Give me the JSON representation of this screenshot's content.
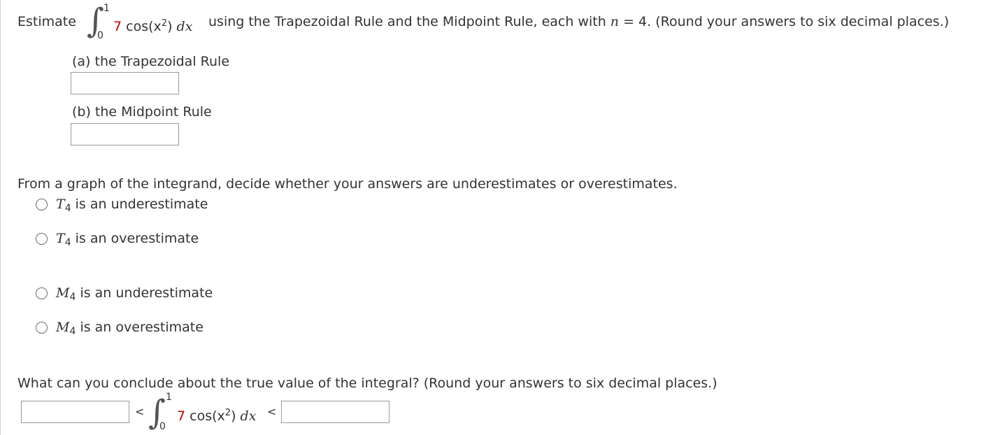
{
  "question": {
    "estimate_label": "Estimate",
    "integral_upper": "1",
    "integral_lower": "0",
    "coefficient": "7",
    "integrand_func": "cos(x",
    "exponent": "2",
    "integrand_close": ")",
    "dx": "dx",
    "instruction_prefix": "using the Trapezoidal Rule and the Midpoint Rule, each with",
    "n_var": "n",
    "instruction_suffix": "= 4. (Round your answers to six decimal places.)"
  },
  "part_a": {
    "label": "(a) the Trapezoidal Rule",
    "value": ""
  },
  "part_b": {
    "label": "(b) the Midpoint Rule",
    "value": ""
  },
  "graph_question": "From a graph of the integrand, decide whether your answers are underestimates or overestimates.",
  "options": [
    {
      "var": "T",
      "sub": "4",
      "text": "is an underestimate"
    },
    {
      "var": "T",
      "sub": "4",
      "text": "is an overestimate"
    },
    {
      "var": "M",
      "sub": "4",
      "text": "is an underestimate"
    },
    {
      "var": "M",
      "sub": "4",
      "text": "is an overestimate"
    }
  ],
  "conclusion": {
    "question": "What can you conclude about the true value of the integral? (Round your answers to six decimal places.)",
    "less_than": "<",
    "lower_value": "",
    "upper_value": ""
  },
  "colors": {
    "coefficient": "#c00000",
    "text": "#333333",
    "box_border": "#9a9a9a"
  }
}
